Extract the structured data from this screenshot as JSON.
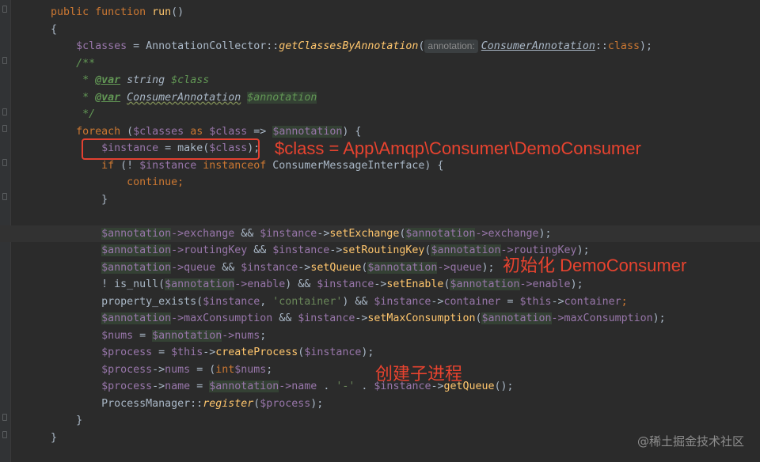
{
  "editor": {
    "lines": [
      {
        "indent": "    ",
        "parts": [
          [
            "kw",
            "public function "
          ],
          [
            "fn",
            "run"
          ],
          [
            "",
            "()"
          ]
        ]
      },
      {
        "indent": "    ",
        "parts": [
          [
            "",
            "{"
          ]
        ]
      },
      {
        "indent": "        ",
        "parts": [
          [
            "var",
            "$classes"
          ],
          [
            "",
            " = AnnotationCollector::"
          ],
          [
            "static",
            "getClassesByAnnotation"
          ],
          [
            "",
            "("
          ],
          [
            "hint",
            "annotation:"
          ],
          [
            "cls-ul",
            "ConsumerAnnotation"
          ],
          [
            "",
            "::"
          ],
          [
            "kw",
            "class"
          ],
          [
            "",
            ");"
          ]
        ]
      },
      {
        "indent": "        ",
        "parts": [
          [
            "doc",
            "/**"
          ]
        ]
      },
      {
        "indent": "         ",
        "parts": [
          [
            "doc",
            "* "
          ],
          [
            "doctag",
            "@var"
          ],
          [
            "doctype",
            " string "
          ],
          [
            "doc",
            "$class"
          ]
        ]
      },
      {
        "indent": "         ",
        "parts": [
          [
            "doc",
            "* "
          ],
          [
            "doctag",
            "@var"
          ],
          [
            "doctype",
            " "
          ],
          [
            "under",
            "ConsumerAnnotation"
          ],
          [
            "doc",
            " "
          ],
          [
            "hl-doc",
            "$annotation"
          ]
        ]
      },
      {
        "indent": "         ",
        "parts": [
          [
            "doc",
            "*/"
          ]
        ]
      },
      {
        "indent": "        ",
        "parts": [
          [
            "kw",
            "foreach "
          ],
          [
            "",
            "("
          ],
          [
            "var",
            "$classes "
          ],
          [
            "kw",
            "as "
          ],
          [
            "var",
            "$class"
          ],
          [
            "",
            " => "
          ],
          [
            "hlvar",
            "$annotation"
          ],
          [
            "",
            ") {"
          ]
        ]
      },
      {
        "indent": "            ",
        "parts": [
          [
            "var",
            "$instance"
          ],
          [
            "",
            " = make("
          ],
          [
            "var",
            "$class"
          ],
          [
            "",
            ");"
          ]
        ]
      },
      {
        "indent": "            ",
        "parts": [
          [
            "kw",
            "if "
          ],
          [
            "",
            "(! "
          ],
          [
            "var",
            "$instance "
          ],
          [
            "kw",
            "instanceof "
          ],
          [
            "",
            "ConsumerMessageInterface) {"
          ]
        ]
      },
      {
        "indent": "                ",
        "parts": [
          [
            "kw",
            "continue"
          ],
          [
            "kw",
            ";"
          ]
        ]
      },
      {
        "indent": "            ",
        "parts": [
          [
            "",
            "}"
          ]
        ]
      },
      {
        "indent": "",
        "parts": []
      },
      {
        "indent": "            ",
        "current": true,
        "parts": [
          [
            "hlvar",
            "$annotation"
          ],
          [
            "var",
            "->exchange "
          ],
          [
            "",
            "&& "
          ],
          [
            "var",
            "$instance"
          ],
          [
            "",
            "->"
          ],
          [
            "fn",
            "setExchange"
          ],
          [
            "",
            "("
          ],
          [
            "hlvar",
            "$annotation"
          ],
          [
            "var",
            "->exchange"
          ],
          [
            "",
            ");"
          ]
        ]
      },
      {
        "indent": "            ",
        "parts": [
          [
            "hlvar",
            "$annotation"
          ],
          [
            "var",
            "->routingKey "
          ],
          [
            "",
            "&& "
          ],
          [
            "var",
            "$instance"
          ],
          [
            "",
            "->"
          ],
          [
            "fn",
            "setRoutingKey"
          ],
          [
            "",
            "("
          ],
          [
            "hlvar",
            "$annotation"
          ],
          [
            "var",
            "->routingKey"
          ],
          [
            "",
            ");"
          ]
        ]
      },
      {
        "indent": "            ",
        "parts": [
          [
            "hlvar",
            "$annotation"
          ],
          [
            "var",
            "->queue "
          ],
          [
            "",
            "&& "
          ],
          [
            "var",
            "$instance"
          ],
          [
            "",
            "->"
          ],
          [
            "fn",
            "setQueue"
          ],
          [
            "",
            "("
          ],
          [
            "hlvar",
            "$annotation"
          ],
          [
            "var",
            "->queue"
          ],
          [
            "",
            ");"
          ]
        ]
      },
      {
        "indent": "            ",
        "parts": [
          [
            "",
            "! is_null("
          ],
          [
            "hlvar",
            "$annotation"
          ],
          [
            "var",
            "->enable"
          ],
          [
            "",
            ") && "
          ],
          [
            "var",
            "$instance"
          ],
          [
            "",
            "->"
          ],
          [
            "fn",
            "setEnable"
          ],
          [
            "",
            "("
          ],
          [
            "hlvar",
            "$annotation"
          ],
          [
            "var",
            "->enable"
          ],
          [
            "",
            ");"
          ]
        ]
      },
      {
        "indent": "            ",
        "parts": [
          [
            "",
            "property_exists("
          ],
          [
            "var",
            "$instance"
          ],
          [
            "",
            ", "
          ],
          [
            "str",
            "'container'"
          ],
          [
            "",
            ") && "
          ],
          [
            "var",
            "$instance"
          ],
          [
            "",
            "->"
          ],
          [
            "var",
            "container"
          ],
          [
            "",
            " = "
          ],
          [
            "var",
            "$this"
          ],
          [
            "",
            "->"
          ],
          [
            "var",
            "container"
          ],
          [
            "kw",
            ";"
          ]
        ]
      },
      {
        "indent": "            ",
        "parts": [
          [
            "hlvar",
            "$annotation"
          ],
          [
            "var",
            "->maxConsumption "
          ],
          [
            "",
            "&& "
          ],
          [
            "var",
            "$instance"
          ],
          [
            "",
            "->"
          ],
          [
            "fn",
            "setMaxConsumption"
          ],
          [
            "",
            "("
          ],
          [
            "hlvar",
            "$annotation"
          ],
          [
            "var",
            "->maxConsumption"
          ],
          [
            "",
            ");"
          ]
        ]
      },
      {
        "indent": "            ",
        "parts": [
          [
            "var",
            "$nums"
          ],
          [
            "",
            " = "
          ],
          [
            "hlvar",
            "$annotation"
          ],
          [
            "var",
            "->nums"
          ],
          [
            "",
            ";"
          ]
        ]
      },
      {
        "indent": "            ",
        "parts": [
          [
            "var",
            "$process"
          ],
          [
            "",
            " = "
          ],
          [
            "var",
            "$this"
          ],
          [
            "",
            "->"
          ],
          [
            "fn",
            "createProcess"
          ],
          [
            "",
            "("
          ],
          [
            "var",
            "$instance"
          ],
          [
            "",
            ");"
          ]
        ]
      },
      {
        "indent": "            ",
        "parts": [
          [
            "var",
            "$process"
          ],
          [
            "",
            "->"
          ],
          [
            "var",
            "nums"
          ],
          [
            "",
            " = ("
          ],
          [
            "kw",
            "int"
          ],
          [
            ") "
          ],
          [
            "var",
            "$nums"
          ],
          [
            "",
            ";"
          ]
        ]
      },
      {
        "indent": "            ",
        "parts": [
          [
            "var",
            "$process"
          ],
          [
            "",
            "->"
          ],
          [
            "var",
            "name"
          ],
          [
            "",
            " = "
          ],
          [
            "hlvar",
            "$annotation"
          ],
          [
            "var",
            "->name"
          ],
          [
            "",
            " . "
          ],
          [
            "str",
            "'-'"
          ],
          [
            "",
            " . "
          ],
          [
            "var",
            "$instance"
          ],
          [
            "",
            "->"
          ],
          [
            "fn",
            "getQueue"
          ],
          [
            "",
            "();"
          ]
        ]
      },
      {
        "indent": "            ",
        "parts": [
          [
            "",
            "ProcessManager::"
          ],
          [
            "static",
            "register"
          ],
          [
            "",
            "("
          ],
          [
            "var",
            "$process"
          ],
          [
            "",
            ");"
          ]
        ]
      },
      {
        "indent": "        ",
        "parts": [
          [
            "",
            "}"
          ]
        ]
      },
      {
        "indent": "    ",
        "parts": [
          [
            "",
            "}"
          ]
        ]
      }
    ]
  },
  "annotations": {
    "class_note": "$class = App\\Amqp\\Consumer\\DemoConsumer",
    "init_note": "初始化 DemoConsumer",
    "process_note": "创建子进程"
  },
  "watermark": "@稀土掘金技术社区",
  "colors": {
    "background": "#2b2b2b",
    "keyword": "#cc7832",
    "function": "#ffc66d",
    "variable": "#9876aa",
    "string": "#6a8759",
    "doc_comment": "#629755",
    "annotation_red": "#e34131"
  }
}
